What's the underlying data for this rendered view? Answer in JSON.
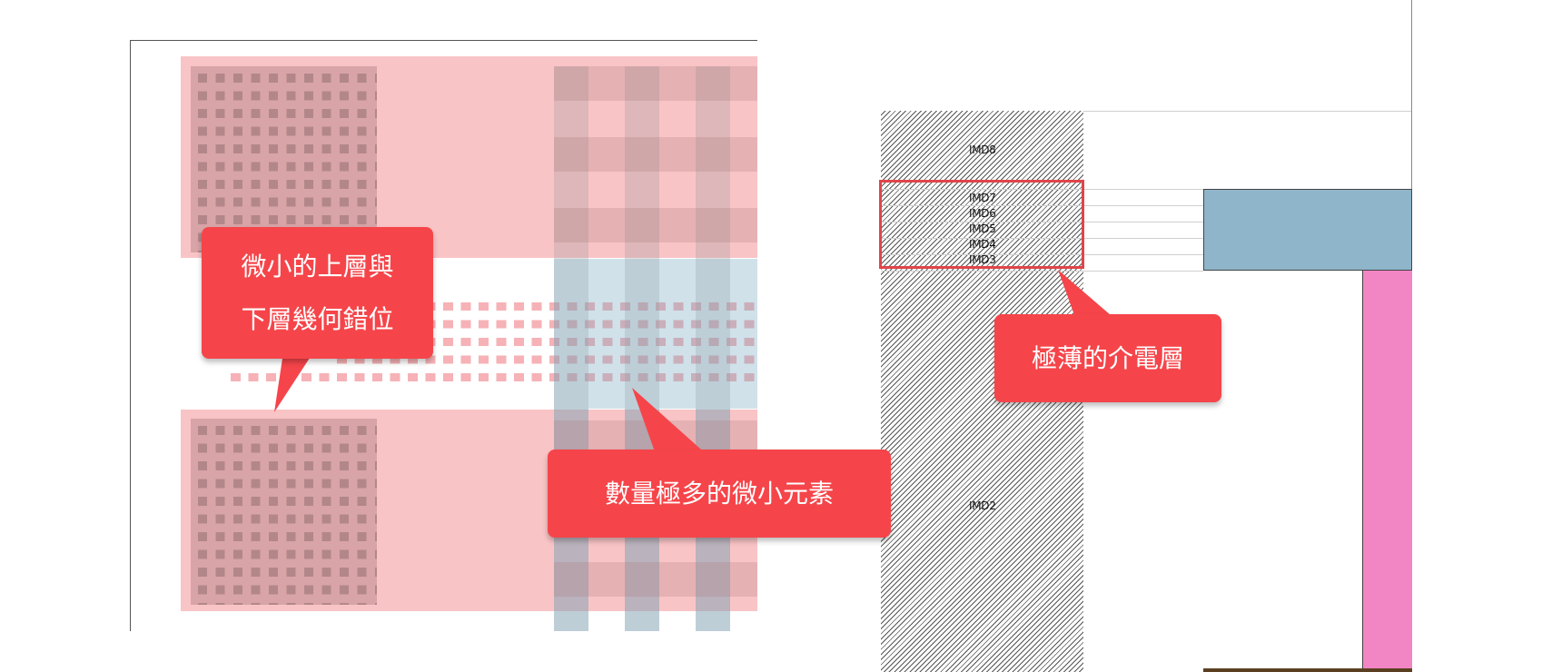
{
  "callouts": {
    "misalign": {
      "line1": "微小的上層與",
      "line2": "下層幾何錯位"
    },
    "many_elements": {
      "text": "數量極多的微小元素"
    },
    "thin_dielectric": {
      "text": "極薄的介電層"
    }
  },
  "cross_section": {
    "layers": [
      "IMD8",
      "IMD7",
      "IMD6",
      "IMD5",
      "IMD4",
      "IMD3",
      "IMD2"
    ]
  },
  "colors": {
    "callout": "#f5454a",
    "pink_band": "#f9c4c6",
    "pad": "#d9a5a8",
    "blue_metal": "#8fb5ca",
    "pink_metal": "#f285c3"
  }
}
